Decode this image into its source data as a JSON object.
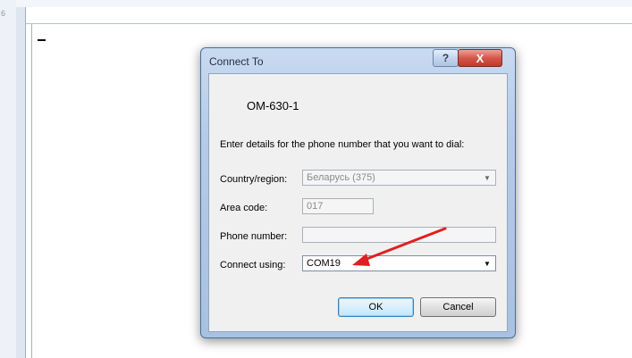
{
  "background": {
    "side_text": "6"
  },
  "dialog": {
    "title": "Connect To",
    "help_glyph": "?",
    "close_glyph": "X",
    "connection_name": "OM-630-1",
    "instructions": "Enter details for the phone number that you want to dial:",
    "fields": {
      "country_label": "Country/region:",
      "country_value": "Беларусь (375)",
      "area_label": "Area code:",
      "area_value": "017",
      "phone_label": "Phone number:",
      "phone_value": "",
      "connect_label": "Connect using:",
      "connect_value": "COM19"
    },
    "buttons": {
      "ok": "OK",
      "cancel": "Cancel"
    }
  },
  "annotation": {
    "arrow_color": "#e02020"
  }
}
